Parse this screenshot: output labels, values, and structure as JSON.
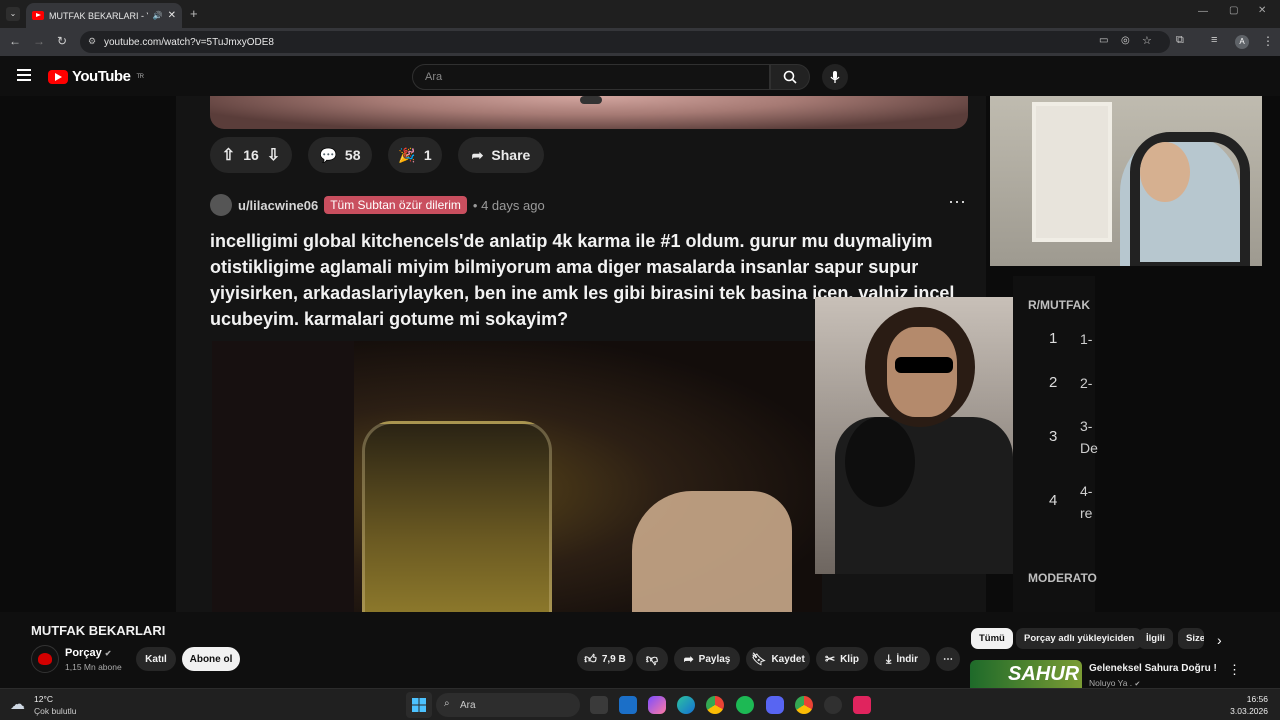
{
  "browser": {
    "tab_title": "MUTFAK BEKARLARI - YouTube",
    "url": "youtube.com/watch?v=5TuJmxyODE8"
  },
  "youtube": {
    "logo_text": "YouTube",
    "region": "TR",
    "search_placeholder": "Ara"
  },
  "post": {
    "upvotes": "16",
    "comments": "58",
    "awards": "1",
    "share_label": "Share",
    "username": "u/lilacwine06",
    "flair": "Tüm Subtan özür dilerim",
    "time": "• 4 days ago",
    "text": "incelligimi global kitchencels'de anlatip 4k karma ile #1 oldum. gurur mu duymaliyim otistikligime aglamali miyim bilmiyorum ama diger masalarda insanlar sapur supur yiyisirken, arkadaslariylayken, ben ine amk les gibi birasini tek basina icen. valniz incel ucubeyim. karmalari gotume mi sokayim?"
  },
  "side_panel": {
    "header": "R/MUTFAK",
    "moderators": "MODERATO",
    "rows": [
      {
        "num": "1",
        "text": "1-"
      },
      {
        "num": "2",
        "text": "2-"
      },
      {
        "num": "3",
        "text": "3-",
        "text2": "De"
      },
      {
        "num": "4",
        "text": "4-",
        "text2": "re"
      }
    ]
  },
  "video": {
    "title": "MUTFAK BEKARLARI",
    "channel": "Porçay",
    "subscribers": "1,15 Mn abone",
    "join_label": "Katıl",
    "subscribe_label": "Abone ol",
    "likes": "7,9 B",
    "share_label": "Paylaş",
    "save_label": "Kaydet",
    "clip_label": "Klip",
    "download_label": "İndir"
  },
  "chips": [
    "Tümü",
    "Porçay adlı yükleyiciden",
    "İlgili",
    "Size"
  ],
  "recommended": {
    "thumb_text": "SAHUR",
    "title": "Geleneksel Sahura Doğru !",
    "channel": "Noluyo Ya ."
  },
  "taskbar": {
    "temp": "12°C",
    "weather": "Çok bulutlu",
    "search_placeholder": "Ara",
    "time": "16:56",
    "date": "3.03.2026"
  }
}
